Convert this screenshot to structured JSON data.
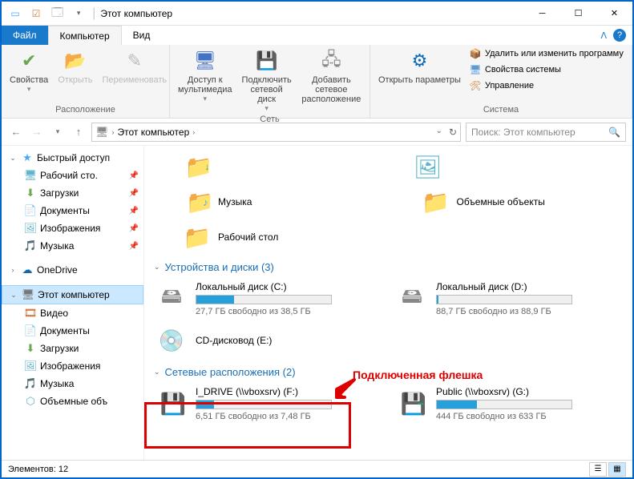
{
  "title": "Этот компьютер",
  "menu": {
    "file": "Файл",
    "computer": "Компьютер",
    "view": "Вид"
  },
  "ribbon": {
    "location": {
      "properties": "Свойства",
      "open": "Открыть",
      "rename": "Переименовать",
      "group": "Расположение"
    },
    "network": {
      "media": "Доступ к мультимедиа",
      "mapdrive": "Подключить сетевой диск",
      "addnet": "Добавить сетевое расположение",
      "group": "Сеть"
    },
    "system": {
      "opensettings": "Открыть параметры",
      "uninstall": "Удалить или изменить программу",
      "sysprops": "Свойства системы",
      "manage": "Управление",
      "group": "Система"
    }
  },
  "addressbar": {
    "path": "Этот компьютер",
    "sep": "›"
  },
  "search": {
    "placeholder": "Поиск: Этот компьютер"
  },
  "sidebar": {
    "quick": {
      "label": "Быстрый доступ",
      "items": [
        {
          "label": "Рабочий сто.",
          "icon": "desktop"
        },
        {
          "label": "Загрузки",
          "icon": "download"
        },
        {
          "label": "Документы",
          "icon": "doc"
        },
        {
          "label": "Изображения",
          "icon": "image"
        },
        {
          "label": "Музыка",
          "icon": "music"
        }
      ]
    },
    "onedrive": "OneDrive",
    "thispc": {
      "label": "Этот компьютер",
      "items": [
        {
          "label": "Видео",
          "icon": "video"
        },
        {
          "label": "Документы",
          "icon": "doc"
        },
        {
          "label": "Загрузки",
          "icon": "download"
        },
        {
          "label": "Изображения",
          "icon": "image"
        },
        {
          "label": "Музыка",
          "icon": "music"
        },
        {
          "label": "Объемные объ",
          "icon": "cube"
        }
      ]
    }
  },
  "content": {
    "topfolders": [
      {
        "label": "",
        "icon": "download"
      },
      {
        "label": "",
        "icon": "picture"
      }
    ],
    "folders": [
      {
        "label": "Музыка",
        "icon": "music"
      },
      {
        "label": "Объемные объекты",
        "icon": "cube"
      },
      {
        "label": "Рабочий стол",
        "icon": "desktop"
      }
    ],
    "drives": {
      "header": "Устройства и диски (3)",
      "items": [
        {
          "name": "Локальный диск (C:)",
          "stat": "27,7 ГБ свободно из 38,5 ГБ",
          "fill": 28
        },
        {
          "name": "Локальный диск (D:)",
          "stat": "88,7 ГБ свободно из 88,9 ГБ",
          "fill": 1
        },
        {
          "name": "CD-дисковод (E:)",
          "stat": "",
          "nobar": true
        }
      ]
    },
    "netloc": {
      "header": "Сетевые расположения (2)",
      "items": [
        {
          "name": "I_DRIVE (\\\\vboxsrv) (F:)",
          "stat": "6,51 ГБ свободно из 7,48 ГБ",
          "fill": 13
        },
        {
          "name": "Public (\\\\vboxsrv) (G:)",
          "stat": "444 ГБ свободно из 633 ГБ",
          "fill": 30
        }
      ]
    }
  },
  "annotation": "Подключенная флешка",
  "statusbar": {
    "count": "Элементов: 12"
  }
}
